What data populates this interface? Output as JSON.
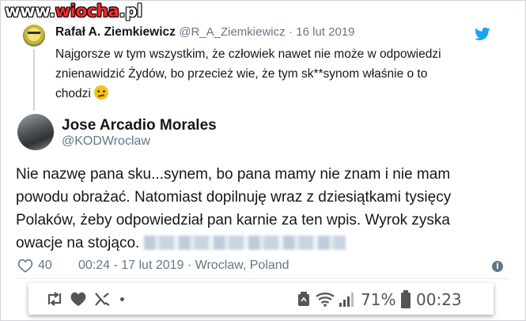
{
  "watermark": {
    "text_a": "www.",
    "text_b": "wiocha",
    "text_c": ".pl"
  },
  "quoted_tweet": {
    "name": "Rafał A. Ziemkiewicz",
    "handle": "@R_A_Ziemkiewicz",
    "separator": "·",
    "date": "16 lut 2019",
    "line1": "Najgorsze w tym wszystkim, że człowiek nawet nie może w odpowiedzi",
    "line2": "znienawidzić Żydów, bo przecież wie, że tym sk**synom właśnie o to",
    "line3": "chodzi",
    "emoji_icon": "thinking-face-icon"
  },
  "main_tweet": {
    "name": "Jose Arcadio Morales",
    "handle": "@KODWroclaw",
    "line1": "Nie nazwę pana sku...synem, bo pana mamy nie znam i nie mam",
    "line2": "powodu obrażać. Natomiast dopilnuję wraz z dziesiątkami tysięcy",
    "line3": "Polaków, żeby odpowiedział pan karnie za ten wpis. Wyrok zyska",
    "line4": "owacje na stojąco."
  },
  "meta": {
    "likes": "40",
    "details": "00:24 - 17 lut 2019 · Wroclaw, Poland",
    "info": "i"
  },
  "statusbar": {
    "battery_percent": "71%",
    "time": "00:23",
    "icons": [
      "retweet-icon",
      "heart-icon",
      "muted-icon",
      "dot-icon",
      "recycle-icon",
      "wifi-icon",
      "signal-icon",
      "battery-icon"
    ]
  },
  "colors": {
    "twitter_blue": "#1da1f2",
    "muted_text": "#657786",
    "watermark_red": "#ff2a2a"
  }
}
